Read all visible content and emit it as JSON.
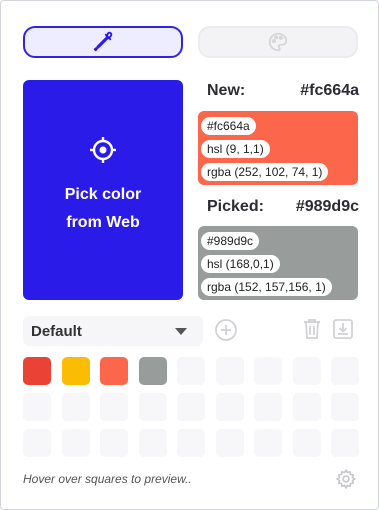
{
  "tabs": [
    {
      "icon": "eyedropper-icon",
      "active": true
    },
    {
      "icon": "palette-icon",
      "active": false
    }
  ],
  "pick_button": {
    "label": "Pick color\nfrom Web",
    "icon": "crosshair-icon",
    "color": "#2b1be8"
  },
  "new_color": {
    "label": "New:",
    "hex_title": "#fc664a",
    "swatch": "#fc664a",
    "hex": "#fc664a",
    "hsl": "hsl (9, 1,1)",
    "rgba": "rgba (252, 102, 74, 1)"
  },
  "picked_color": {
    "label": "Picked:",
    "hex_title": "#989d9c",
    "swatch": "#989d9c",
    "hex": "#989d9c",
    "hsl": "hsl (168,0,1)",
    "rgba": "rgba (152, 157,156, 1)"
  },
  "palette": {
    "selected": "Default",
    "swatches": [
      "#ea4335",
      "#fbbc04",
      "#fc664a",
      "#989d9c"
    ],
    "total_slots": 27
  },
  "hint": "Hover over squares to preview..",
  "colors": {
    "accent": "#3122e6",
    "empty_cell": "#f7f6f8"
  }
}
